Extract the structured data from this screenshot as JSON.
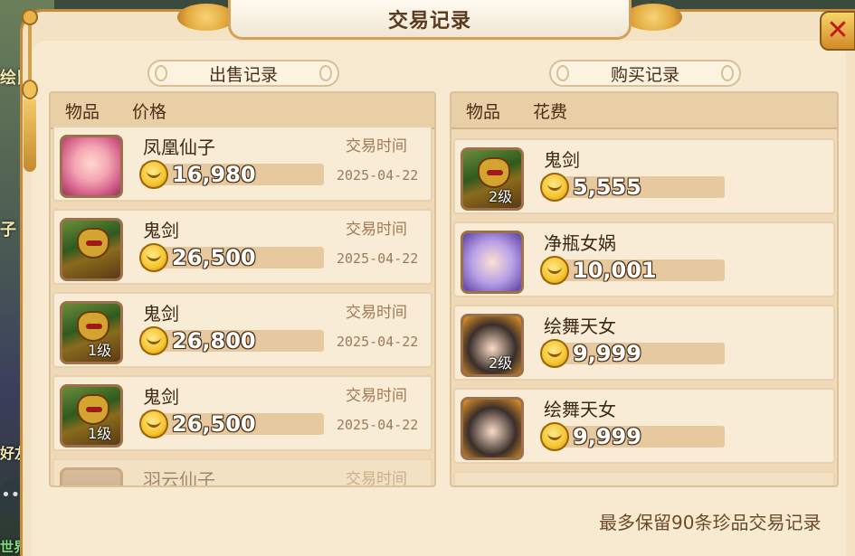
{
  "window": {
    "title": "交易记录"
  },
  "background": {
    "labels": [
      "绘鼠",
      "子",
      "好友",
      "世界"
    ]
  },
  "sell": {
    "header": "出售记录",
    "col_item": "物品",
    "col_price": "价格",
    "rows": [
      {
        "name": "凤凰仙子",
        "price": "16,980",
        "trade_label": "交易时间",
        "date": "2025-04-22",
        "level": "",
        "avatar": "phoenix-fairy"
      },
      {
        "name": "鬼剑",
        "price": "26,500",
        "trade_label": "交易时间",
        "date": "2025-04-22",
        "level": "",
        "avatar": "ghost-sword"
      },
      {
        "name": "鬼剑",
        "price": "26,800",
        "trade_label": "交易时间",
        "date": "2025-04-22",
        "level": "1级",
        "avatar": "ghost-sword"
      },
      {
        "name": "鬼剑",
        "price": "26,500",
        "trade_label": "交易时间",
        "date": "2025-04-22",
        "level": "1级",
        "avatar": "ghost-sword"
      },
      {
        "name": "羽云仙子",
        "price": "",
        "trade_label": "交易时间",
        "date": "",
        "level": "",
        "avatar": "feather-fairy"
      }
    ]
  },
  "buy": {
    "header": "购买记录",
    "col_item": "物品",
    "col_cost": "花费",
    "rows": [
      {
        "name": "鬼剑",
        "price": "5,555",
        "level": "2级",
        "avatar": "ghost-sword"
      },
      {
        "name": "净瓶女娲",
        "price": "10,001",
        "level": "",
        "avatar": "vase-nuwa"
      },
      {
        "name": "绘舞天女",
        "price": "9,999",
        "level": "2级",
        "avatar": "dancing-goddess"
      },
      {
        "name": "绘舞天女",
        "price": "9,999",
        "level": "",
        "avatar": "dancing-goddess"
      }
    ]
  },
  "footer": {
    "note": "最多保留90条珍品交易记录"
  },
  "icons": {
    "close": "close-icon",
    "coin": "gold-coin-icon",
    "chat": "chat-icon"
  }
}
